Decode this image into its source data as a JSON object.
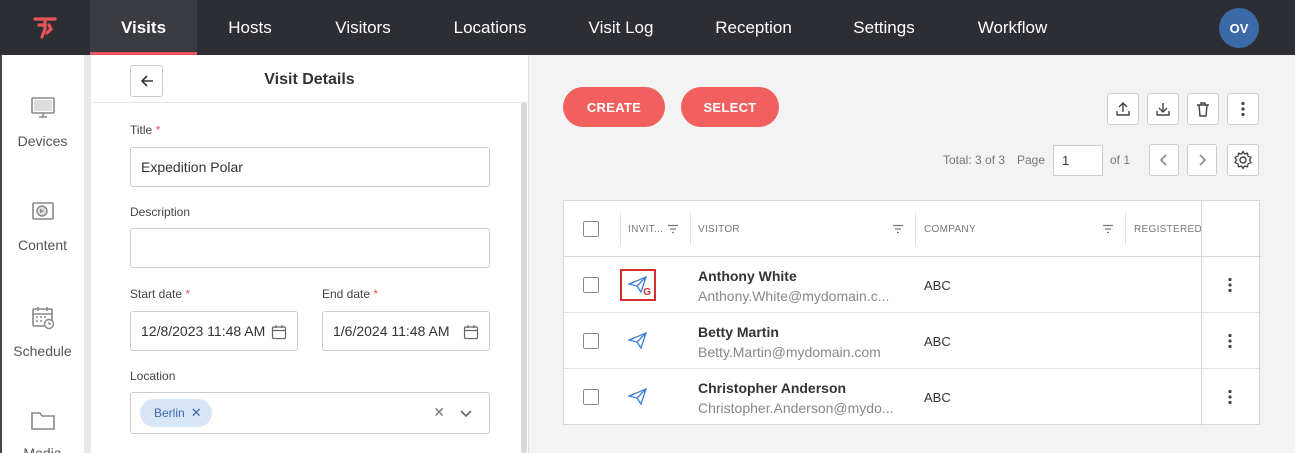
{
  "nav": {
    "logo_icon": "brand-logo-icon",
    "items": [
      {
        "label": "Visits",
        "active": true
      },
      {
        "label": "Hosts"
      },
      {
        "label": "Visitors"
      },
      {
        "label": "Locations"
      },
      {
        "label": "Visit Log"
      },
      {
        "label": "Reception"
      },
      {
        "label": "Settings"
      },
      {
        "label": "Workflow"
      }
    ],
    "avatar_initials": "OV"
  },
  "sidebar": {
    "items": [
      {
        "label": "Devices",
        "icon": "monitor-icon"
      },
      {
        "label": "Content",
        "icon": "content-icon"
      },
      {
        "label": "Schedule",
        "icon": "calendar-icon"
      },
      {
        "label": "Media",
        "icon": "folder-icon"
      }
    ]
  },
  "details": {
    "title": "Visit Details",
    "fields": {
      "title_label": "Title",
      "title_value": "Expedition Polar",
      "description_label": "Description",
      "description_value": "",
      "start_label": "Start date",
      "start_value": "12/8/2023 11:48 AM",
      "end_label": "End date",
      "end_value": "1/6/2024 11:48 AM",
      "location_label": "Location",
      "location_chip": "Berlin"
    },
    "required_mark": "*"
  },
  "toolbar": {
    "create_label": "CREATE",
    "select_label": "SELECT"
  },
  "pager": {
    "total": "Total: 3 of 3",
    "page_label": "Page",
    "page_value": "1",
    "of_label": "of 1"
  },
  "grid": {
    "columns": [
      "INVIT...",
      "VISITOR",
      "COMPANY",
      "REGISTERED"
    ],
    "rows": [
      {
        "name": "Anthony White",
        "email": "Anthony.White@mydomain.c...",
        "company": "ABC",
        "invite_badge": "G"
      },
      {
        "name": "Betty Martin",
        "email": "Betty.Martin@mydomain.com",
        "company": "ABC",
        "invite_badge": ""
      },
      {
        "name": "Christopher Anderson",
        "email": "Christopher.Anderson@mydo...",
        "company": "ABC",
        "invite_badge": ""
      }
    ]
  },
  "colors": {
    "accent": "#f1605f",
    "nav_bg": "#2d2e33",
    "avatar": "#3b6aa8",
    "highlight": "#d32f2f"
  }
}
